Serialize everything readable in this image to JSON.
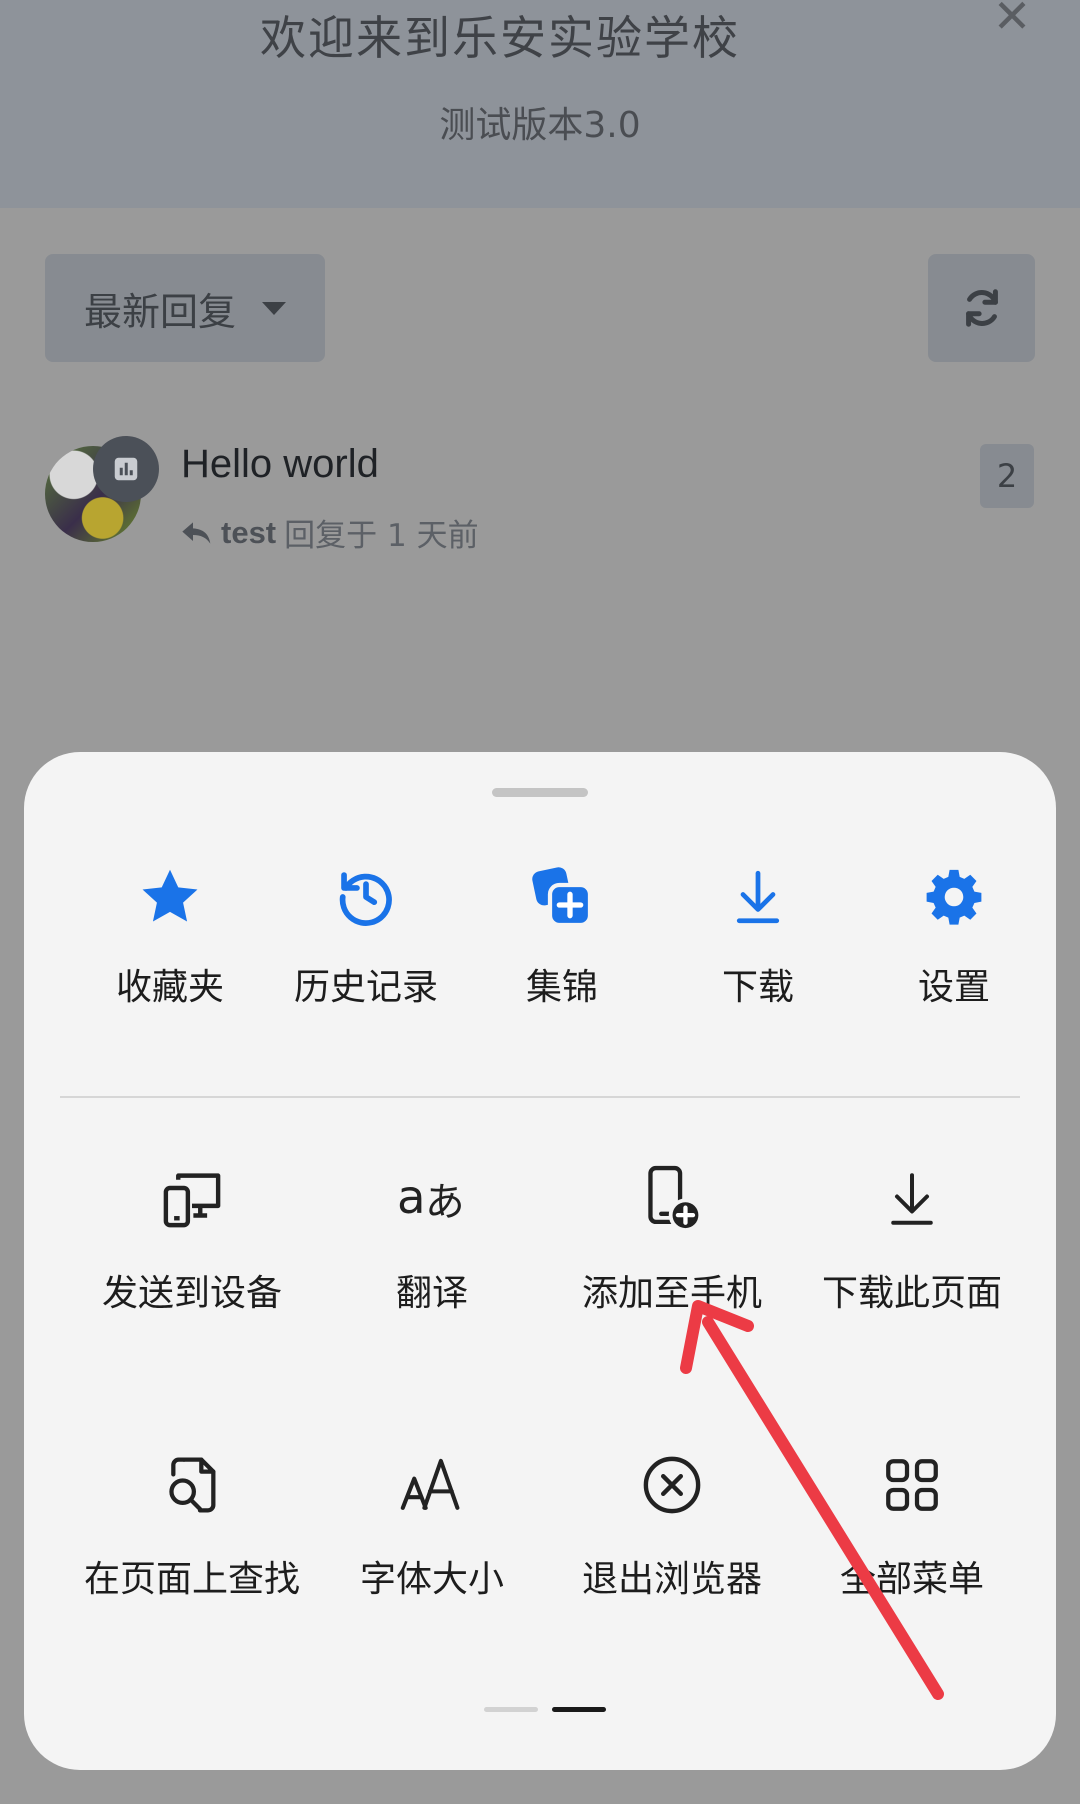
{
  "banner": {
    "title": "欢迎来到乐安实验学校",
    "subtitle": "测试版本3.0",
    "close_icon": "close-icon"
  },
  "toolbar": {
    "sort_label": "最新回复",
    "sort_icon": "caret-down-icon",
    "refresh_icon": "refresh-icon"
  },
  "topic": {
    "title": "Hello world",
    "last_poster": "test",
    "reply_text": "回复于 1 天前",
    "reply_count": "2",
    "reply_icon": "reply-arrow-icon"
  },
  "sheet": {
    "top_items": [
      {
        "label": "收藏夹",
        "icon": "star-icon"
      },
      {
        "label": "历史记录",
        "icon": "history-icon"
      },
      {
        "label": "集锦",
        "icon": "collection-add-icon"
      },
      {
        "label": "下载",
        "icon": "download-icon"
      },
      {
        "label": "设置",
        "icon": "gear-icon"
      }
    ],
    "menu_row1": [
      {
        "label": "发送到设备",
        "icon": "send-to-device-icon"
      },
      {
        "label": "翻译",
        "icon": "translate-icon"
      },
      {
        "label": "添加至手机",
        "icon": "add-to-phone-icon"
      },
      {
        "label": "下载此页面",
        "icon": "download-page-icon"
      }
    ],
    "menu_row2": [
      {
        "label": "在页面上查找",
        "icon": "find-in-page-icon"
      },
      {
        "label": "字体大小",
        "icon": "font-size-icon"
      },
      {
        "label": "退出浏览器",
        "icon": "exit-icon"
      },
      {
        "label": "全部菜单",
        "icon": "all-menu-grid-icon"
      }
    ],
    "page_indicator": {
      "pages": 2,
      "current": 2
    }
  },
  "colors": {
    "accent_blue": "#1a73e8",
    "annotation_red": "#ec3b45",
    "sheet_bg": "#f4f4f4"
  }
}
